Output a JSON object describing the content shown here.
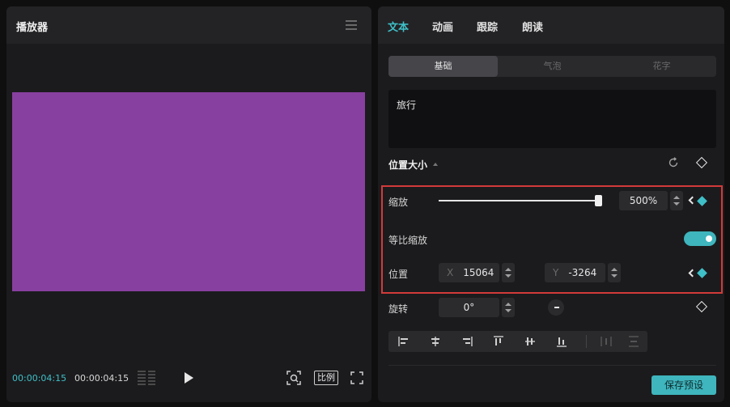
{
  "player": {
    "title": "播放器",
    "current_time": "00:00:04:15",
    "total_time": "00:00:04:15",
    "ratio_label": "比例",
    "video_color": "#8840a0"
  },
  "inspector": {
    "tabs": [
      {
        "label": "文本",
        "active": true
      },
      {
        "label": "动画",
        "active": false
      },
      {
        "label": "跟踪",
        "active": false
      },
      {
        "label": "朗读",
        "active": false
      }
    ],
    "subtabs": [
      {
        "label": "基础",
        "active": true
      },
      {
        "label": "气泡",
        "active": false
      },
      {
        "label": "花字",
        "active": false
      }
    ],
    "text_content": "旅行",
    "section_title": "位置大小",
    "scale": {
      "label": "缩放",
      "value": "500%",
      "slider_fraction": 1.0
    },
    "uniform_scale": {
      "label": "等比缩放",
      "enabled": true
    },
    "position": {
      "label": "位置",
      "x_axis": "X",
      "x_value": "15064",
      "y_axis": "Y",
      "y_value": "-3264"
    },
    "rotation": {
      "label": "旋转",
      "value": "0°"
    },
    "save_preset_label": "保存预设"
  },
  "colors": {
    "accent": "#3fc0c8",
    "highlight_border": "#d23a3a"
  }
}
